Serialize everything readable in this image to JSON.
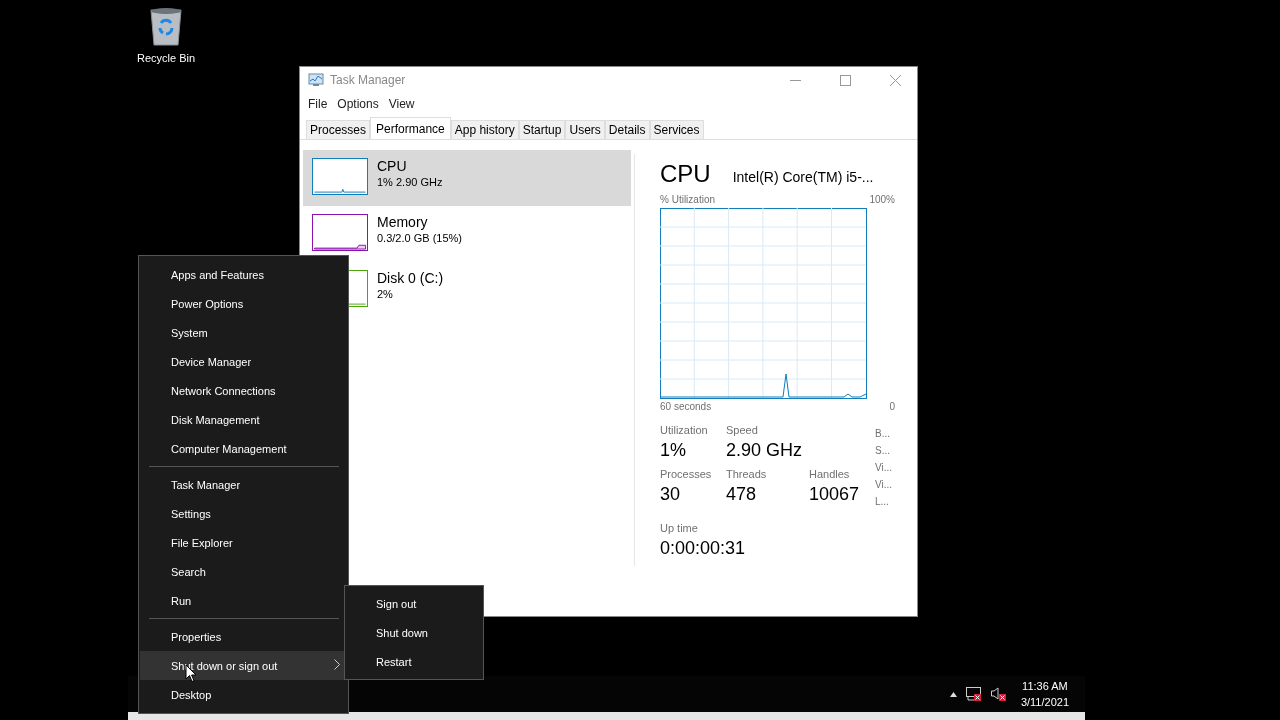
{
  "desktop_icons": [
    {
      "label": "Recycle Bin"
    }
  ],
  "task_manager": {
    "title": "Task Manager",
    "menu": [
      "File",
      "Options",
      "View"
    ],
    "tabs": [
      {
        "label": "Processes",
        "selected": false
      },
      {
        "label": "Performance",
        "selected": true
      },
      {
        "label": "App history",
        "selected": false
      },
      {
        "label": "Startup",
        "selected": false
      },
      {
        "label": "Users",
        "selected": false
      },
      {
        "label": "Details",
        "selected": false
      },
      {
        "label": "Services",
        "selected": false
      }
    ],
    "resources": [
      {
        "name": "CPU",
        "detail": "1% 2.90 GHz",
        "selected": true,
        "color": "#117dbb"
      },
      {
        "name": "Memory",
        "detail": "0.3/2.0 GB (15%)",
        "selected": false,
        "color": "#8b12ae"
      },
      {
        "name": "Disk 0 (C:)",
        "detail": "2%",
        "selected": false,
        "color": "#4da60c"
      }
    ],
    "detail": {
      "title": "CPU",
      "model": "Intel(R) Core(TM) i5-...",
      "graph_label": "% Utilization",
      "graph_max": "100%",
      "graph_span": "60 seconds",
      "graph_min": "0",
      "stat_rows": [
        [
          {
            "label": "Utilization",
            "value": "1%"
          },
          {
            "label": "Speed",
            "value": "2.90 GHz"
          }
        ],
        [
          {
            "label": "Processes",
            "value": "30"
          },
          {
            "label": "Threads",
            "value": "478"
          },
          {
            "label": "Handles",
            "value": "10067"
          }
        ]
      ],
      "uptime": {
        "label": "Up time",
        "value": "0:00:00:31"
      },
      "side_labels": [
        "B...",
        "S...",
        "Vi...",
        "Vi...",
        "L..."
      ]
    }
  },
  "context_menu": {
    "groups": [
      [
        {
          "label": "Apps and Features",
          "selected": false,
          "has_submenu": false
        },
        {
          "label": "Power Options",
          "selected": false,
          "has_submenu": false
        },
        {
          "label": "System",
          "selected": false,
          "has_submenu": false
        },
        {
          "label": "Device Manager",
          "selected": false,
          "has_submenu": false
        },
        {
          "label": "Network Connections",
          "selected": false,
          "has_submenu": false
        },
        {
          "label": "Disk Management",
          "selected": false,
          "has_submenu": false
        },
        {
          "label": "Computer Management",
          "selected": false,
          "has_submenu": false
        }
      ],
      [
        {
          "label": "Task Manager",
          "selected": false,
          "has_submenu": false
        },
        {
          "label": "Settings",
          "selected": false,
          "has_submenu": false
        },
        {
          "label": "File Explorer",
          "selected": false,
          "has_submenu": false
        },
        {
          "label": "Search",
          "selected": false,
          "has_submenu": false
        },
        {
          "label": "Run",
          "selected": false,
          "has_submenu": false
        }
      ],
      [
        {
          "label": "Properties",
          "selected": false,
          "has_submenu": false
        },
        {
          "label": "Shut down or sign out",
          "selected": true,
          "has_submenu": true
        },
        {
          "label": "Desktop",
          "selected": false,
          "has_submenu": false
        }
      ]
    ],
    "submenu": [
      "Sign out",
      "Shut down",
      "Restart"
    ]
  },
  "taskbar": {
    "time": "11:36 AM",
    "date": "3/11/2021",
    "network_error": true,
    "sound_muted": true
  }
}
